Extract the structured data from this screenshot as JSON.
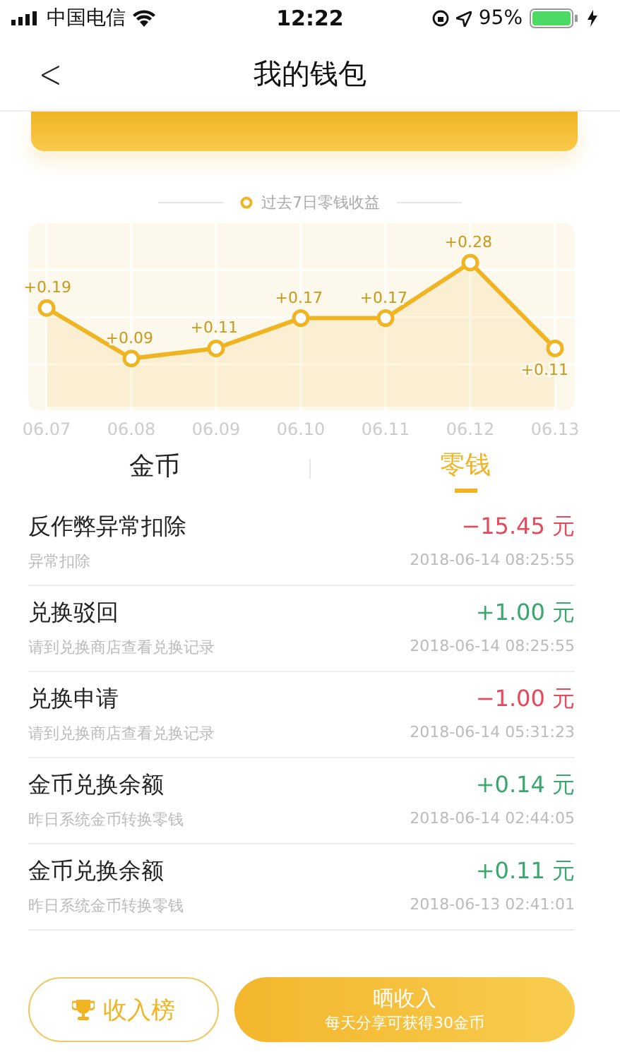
{
  "status_bar": {
    "carrier": "中国电信",
    "time": "12:22",
    "battery": "95%"
  },
  "nav": {
    "back": "<",
    "title": "我的钱包"
  },
  "chart": {
    "chart_data": {
      "type": "area",
      "grid": true,
      "title": "过去7日零钱收益",
      "categories": [
        "06.07",
        "06.08",
        "06.09",
        "06.10",
        "06.11",
        "06.12",
        "06.13"
      ],
      "series": [
        {
          "color": "#f0b422",
          "values": [
            0.19,
            0.09,
            0.11,
            0.17,
            0.17,
            0.28,
            0.11
          ]
        }
      ],
      "data_labels": true
    },
    "label_sign": "+"
  },
  "tabs": [
    {
      "label": "金币",
      "selected": false
    },
    {
      "label": "零钱",
      "selected": true
    }
  ],
  "records": [
    {
      "title": "反作弊异常扣除",
      "amount": "−15.45 元",
      "kind": "debit",
      "note": "异常扣除",
      "time": "2018-06-14 08:25:55"
    },
    {
      "title": "兑换驳回",
      "amount": "+1.00 元",
      "kind": "credit",
      "note": "请到兑换商店查看兑换记录",
      "time": "2018-06-14 08:25:55"
    },
    {
      "title": "兑换申请",
      "amount": "−1.00 元",
      "kind": "debit",
      "note": "请到兑换商店查看兑换记录",
      "time": "2018-06-14 05:31:23"
    },
    {
      "title": "金币兑换余额",
      "amount": "+0.14 元",
      "kind": "credit",
      "note": "昨日系统金币转换零钱",
      "time": "2018-06-14 02:44:05"
    },
    {
      "title": "金币兑换余额",
      "amount": "+0.11 元",
      "kind": "credit",
      "note": "昨日系统金币转换零钱",
      "time": "2018-06-13 02:41:01"
    }
  ],
  "buttons": {
    "ranking": "收入榜",
    "share": "晒收入",
    "share_note": "每天分享可获得30金币"
  }
}
